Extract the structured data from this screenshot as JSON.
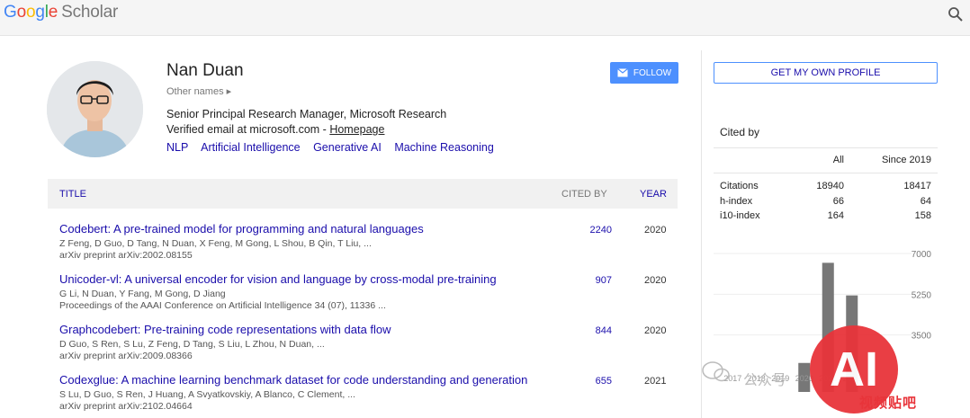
{
  "header": {
    "logo_google": [
      "G",
      "o",
      "o",
      "g",
      "l",
      "e"
    ],
    "logo_scholar": "Scholar",
    "search_icon": "search-icon"
  },
  "profile": {
    "name": "Nan Duan",
    "other_names": "Other names ▸",
    "affiliation": "Senior Principal Research Manager, Microsoft Research",
    "email_text": "Verified email at microsoft.com - ",
    "homepage_label": "Homepage",
    "interests": [
      "NLP",
      "Artificial Intelligence",
      "Generative AI",
      "Machine Reasoning"
    ],
    "follow_label": "FOLLOW",
    "get_profile_label": "GET MY OWN PROFILE"
  },
  "table": {
    "col_title": "TITLE",
    "col_cited": "CITED BY",
    "col_year": "YEAR",
    "rows": [
      {
        "title": "Codebert: A pre-trained model for programming and natural languages",
        "authors": "Z Feng, D Guo, D Tang, N Duan, X Feng, M Gong, L Shou, B Qin, T Liu, ...",
        "venue": "arXiv preprint arXiv:2002.08155",
        "cited": "2240",
        "year": "2020"
      },
      {
        "title": "Unicoder-vl: A universal encoder for vision and language by cross-modal pre-training",
        "authors": "G Li, N Duan, Y Fang, M Gong, D Jiang",
        "venue": "Proceedings of the AAAI Conference on Artificial Intelligence 34 (07), 11336 ...",
        "cited": "907",
        "year": "2020"
      },
      {
        "title": "Graphcodebert: Pre-training code representations with data flow",
        "authors": "D Guo, S Ren, S Lu, Z Feng, D Tang, S Liu, L Zhou, N Duan, ...",
        "venue": "arXiv preprint arXiv:2009.08366",
        "cited": "844",
        "year": "2020"
      },
      {
        "title": "Codexglue: A machine learning benchmark dataset for code understanding and generation",
        "authors": "S Lu, D Guo, S Ren, J Huang, A Svyatkovskiy, A Blanco, C Clement, ...",
        "venue": "arXiv preprint arXiv:2102.04664",
        "cited": "655",
        "year": "2021"
      }
    ]
  },
  "cited_by": {
    "title": "Cited by",
    "col_all": "All",
    "col_since": "Since 2019",
    "rows": [
      {
        "label": "Citations",
        "all": "18940",
        "since": "18417"
      },
      {
        "label": "h-index",
        "all": "66",
        "since": "64"
      },
      {
        "label": "i10-index",
        "all": "164",
        "since": "158"
      }
    ]
  },
  "chart_data": {
    "type": "bar",
    "categories": [
      "2017",
      "2018",
      "2019",
      "2020",
      "2021",
      "2022"
    ],
    "values": [
      null,
      null,
      null,
      2300,
      6600,
      5200
    ],
    "y_ticks": [
      "7000",
      "5250",
      "3500"
    ],
    "ylim": [
      1750,
      7000
    ],
    "bar_color": "#777777"
  },
  "watermark": {
    "ai": "AI",
    "caption": "视频贴吧",
    "chat_text": "公众号"
  },
  "colors": {
    "link": "#1a0dab",
    "button_blue": "#4d90fe"
  }
}
